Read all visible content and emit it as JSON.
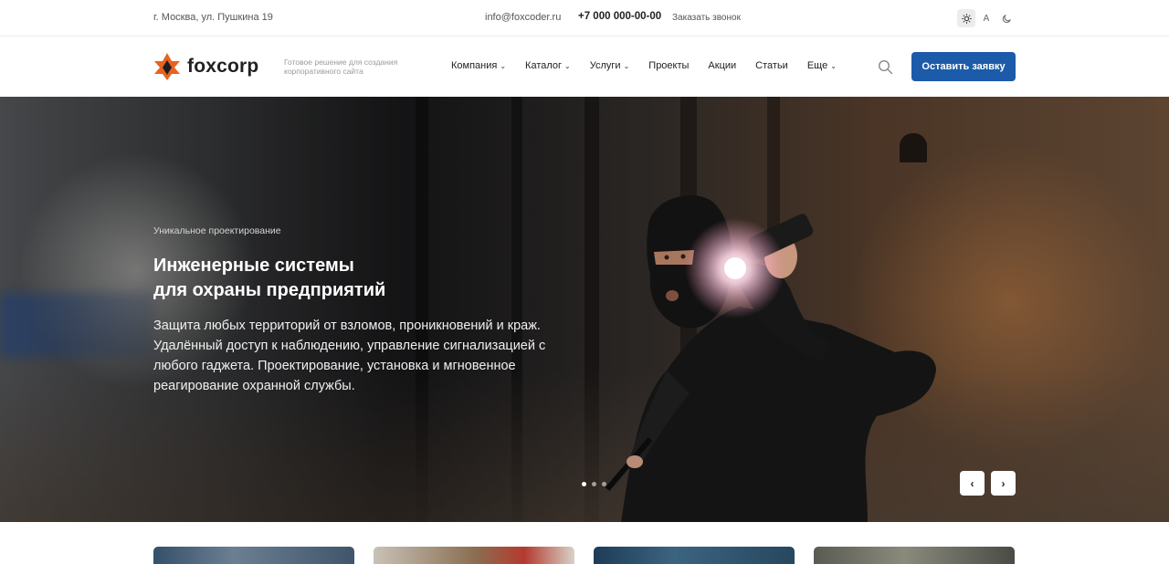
{
  "topbar": {
    "address": "г. Москва, ул. Пушкина 19",
    "email": "info@foxcoder.ru",
    "phone": "+7 000 000-00-00",
    "callback": "Заказать звонок",
    "theme_icons": [
      "sun-icon",
      "a-icon",
      "moon-icon"
    ],
    "theme_letter": "A"
  },
  "header": {
    "logo_text": "foxcorp",
    "logo_color": "#e8631e",
    "tagline": "Готовое решение для создания корпоративного сайта",
    "nav": [
      {
        "label": "Компания",
        "has_dropdown": true
      },
      {
        "label": "Каталог",
        "has_dropdown": true
      },
      {
        "label": "Услуги",
        "has_dropdown": true
      },
      {
        "label": "Проекты",
        "has_dropdown": false
      },
      {
        "label": "Акции",
        "has_dropdown": false
      },
      {
        "label": "Статьи",
        "has_dropdown": false
      },
      {
        "label": "Еще",
        "has_dropdown": true
      }
    ],
    "cta": "Оставить заявку",
    "cta_color": "#1c5ba9"
  },
  "hero": {
    "kicker": "Уникальное проектирование",
    "title_line1": "Инженерные системы",
    "title_line2": "для охраны предприятий",
    "description": "Защита любых территорий от взломов, проникновений и краж. Удалённый доступ к наблюдению, управление сигнализацией с любого гаджета. Проектирование, установка и мгновенное реагирование охранной службы.",
    "slides_total": 3,
    "active_slide": 1,
    "prev_symbol": "‹",
    "next_symbol": "›"
  },
  "cards_count": 4
}
